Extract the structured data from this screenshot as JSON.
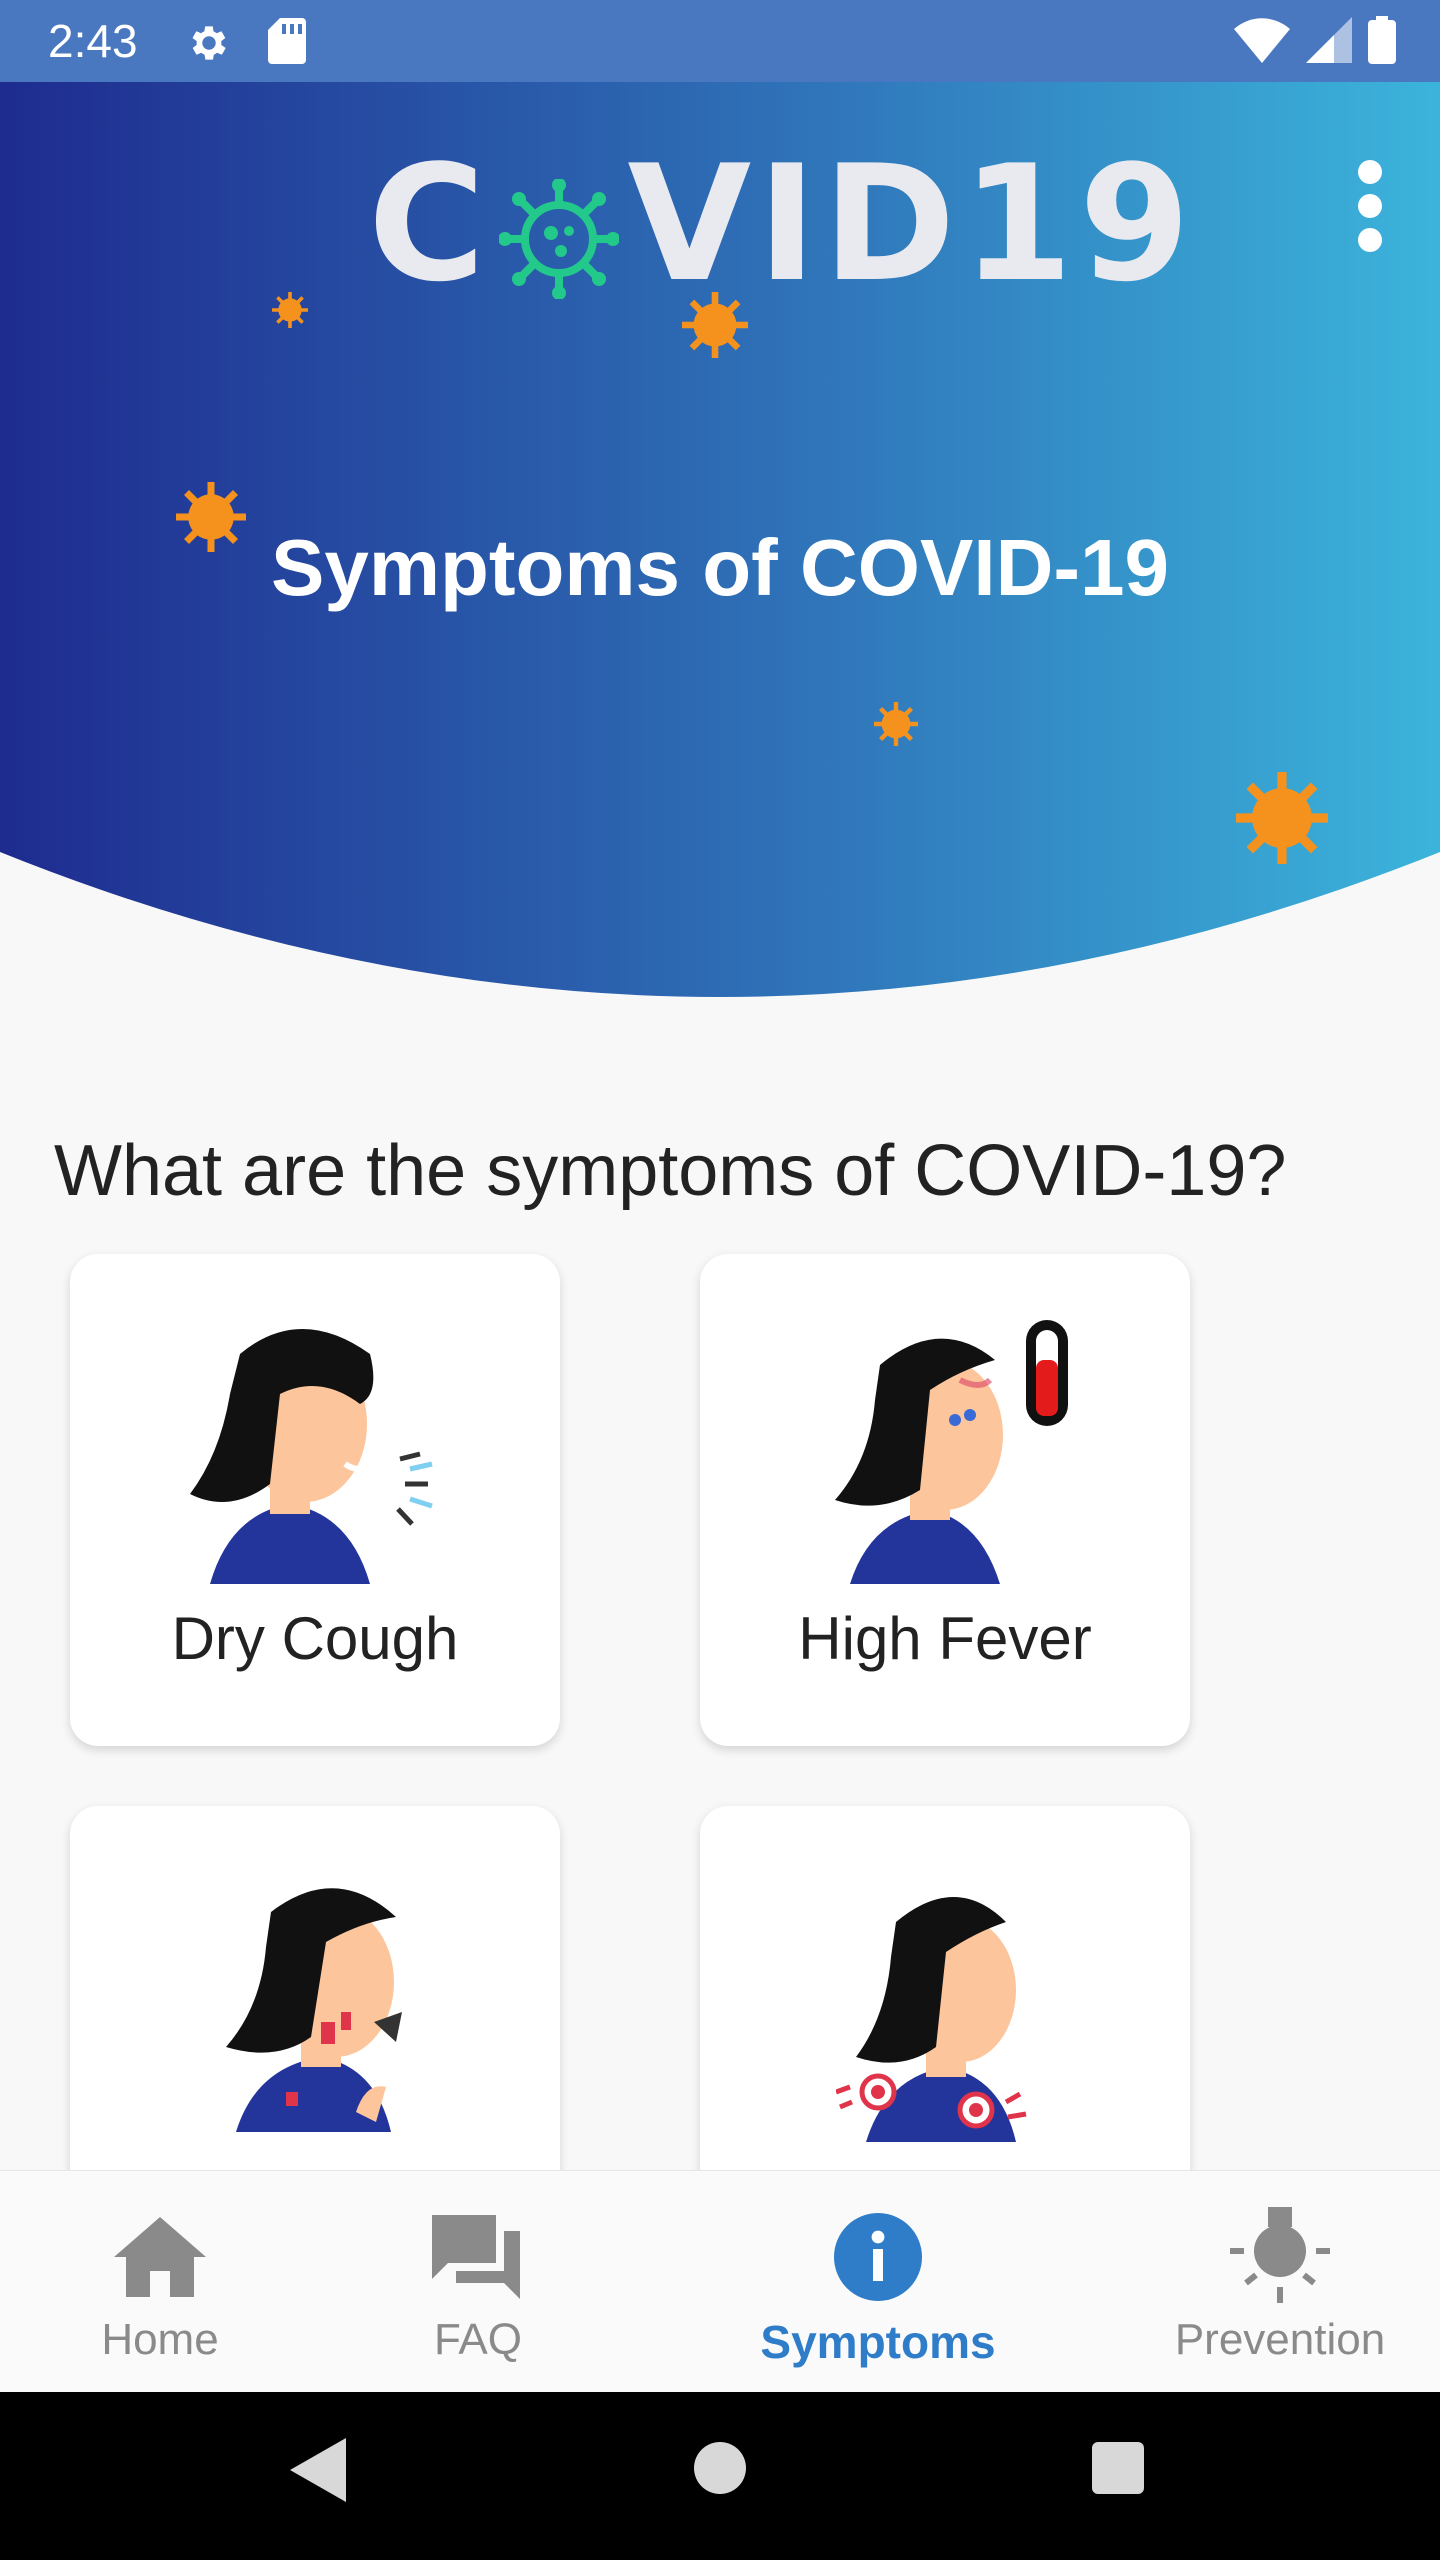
{
  "status_bar": {
    "time": "2:43",
    "icons": [
      "gear-icon",
      "sd-card-icon",
      "wifi-icon",
      "cell-signal-icon",
      "battery-icon"
    ]
  },
  "header": {
    "logo_text_left": "C",
    "logo_text_right": "VID19",
    "logo_icon": "virus-icon",
    "title": "Symptoms of COVID-19",
    "menu_icon": "more-vert-icon",
    "gradient": [
      "#1e2b8f",
      "#3bb4db"
    ]
  },
  "main": {
    "heading": "What are the symptoms of COVID-19?",
    "cards": [
      {
        "label": "Dry Cough",
        "icon": "woman-coughing-icon"
      },
      {
        "label": "High Fever",
        "icon": "woman-fever-icon"
      },
      {
        "label": "",
        "icon": "woman-sore-throat-icon"
      },
      {
        "label": "",
        "icon": "woman-body-ache-icon"
      }
    ]
  },
  "bottom_nav": {
    "items": [
      {
        "label": "Home",
        "icon": "home-icon",
        "active": false
      },
      {
        "label": "FAQ",
        "icon": "chat-bubbles-icon",
        "active": false
      },
      {
        "label": "Symptoms",
        "icon": "info-icon",
        "active": true
      },
      {
        "label": "Prevention",
        "icon": "lightbulb-icon",
        "active": false
      }
    ],
    "active_color": "#2f7cc9",
    "inactive_color": "#8a8a8a"
  },
  "system_nav": {
    "buttons": [
      "back-icon",
      "home-circle-icon",
      "recents-icon"
    ]
  }
}
